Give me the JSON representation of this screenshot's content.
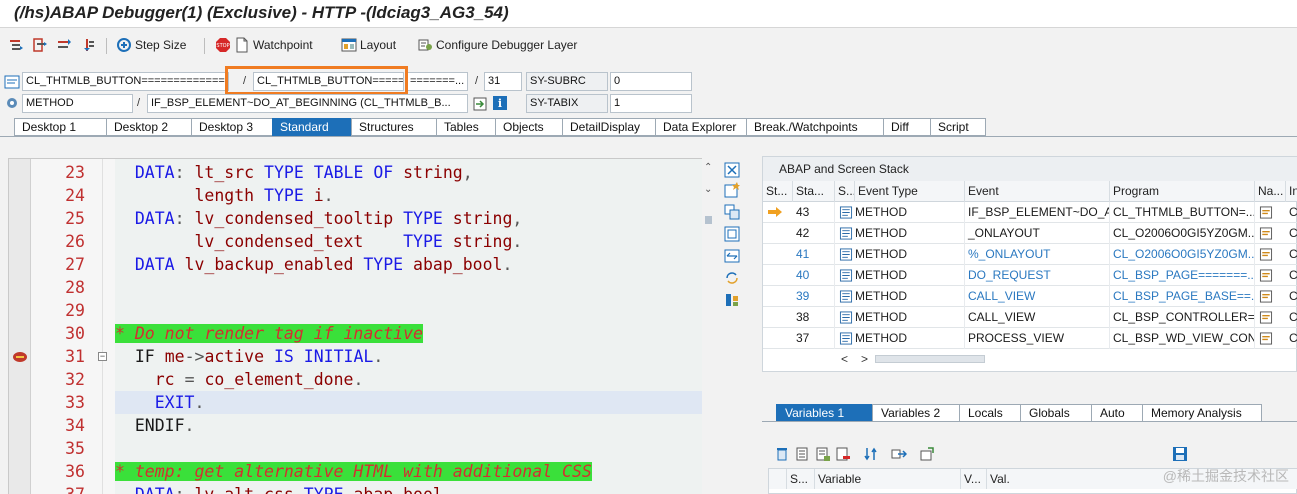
{
  "window": {
    "title": "(/hs)ABAP Debugger(1)  (Exclusive) - HTTP -(ldciag3_AG3_54)"
  },
  "toolbar": {
    "step_size": "Step Size",
    "watchpoint": "Watchpoint",
    "layout": "Layout",
    "configure": "Configure Debugger Layer"
  },
  "info": {
    "program": "CL_THTMLB_BUTTON=============",
    "include": "CL_THTMLB_BUTTON=====",
    "include_suffix": "=======...",
    "line": "31",
    "sysubrc_label": "SY-SUBRC",
    "sysubrc_value": "0",
    "event_type": "METHOD",
    "event": "IF_BSP_ELEMENT~DO_AT_BEGINNING (CL_THTMLB_B...",
    "sytabix_label": "SY-TABIX",
    "sytabix_value": "1"
  },
  "tabs": [
    "Desktop 1",
    "Desktop 2",
    "Desktop 3",
    "Standard",
    "Structures",
    "Tables",
    "Objects",
    "DetailDisplay",
    "Data Explorer",
    "Break./Watchpoints",
    "Diff",
    "Script"
  ],
  "active_tab": "Standard",
  "code": {
    "current_line": 33,
    "breakpoint_line": 31,
    "lines": [
      {
        "n": "23",
        "tokens": [
          [
            "pl",
            "  "
          ],
          [
            "kw",
            "DATA"
          ],
          [
            "op",
            ": "
          ],
          [
            "id",
            "lt_src "
          ],
          [
            "kw",
            "TYPE TABLE OF "
          ],
          [
            "id",
            "string"
          ],
          [
            "op",
            ","
          ]
        ]
      },
      {
        "n": "24",
        "tokens": [
          [
            "pl",
            "        "
          ],
          [
            "id",
            "length "
          ],
          [
            "kw",
            "TYPE "
          ],
          [
            "id",
            "i"
          ],
          [
            "op",
            "."
          ]
        ]
      },
      {
        "n": "25",
        "tokens": [
          [
            "pl",
            "  "
          ],
          [
            "kw",
            "DATA"
          ],
          [
            "op",
            ": "
          ],
          [
            "id",
            "lv_condensed_tooltip "
          ],
          [
            "kw",
            "TYPE "
          ],
          [
            "id",
            "string"
          ],
          [
            "op",
            ","
          ]
        ]
      },
      {
        "n": "26",
        "tokens": [
          [
            "pl",
            "        "
          ],
          [
            "id",
            "lv_condensed_text    "
          ],
          [
            "kw",
            "TYPE "
          ],
          [
            "id",
            "string"
          ],
          [
            "op",
            "."
          ]
        ]
      },
      {
        "n": "27",
        "tokens": [
          [
            "pl",
            "  "
          ],
          [
            "kw",
            "DATA "
          ],
          [
            "id",
            "lv_backup_enabled "
          ],
          [
            "kw",
            "TYPE "
          ],
          [
            "id",
            "abap_bool"
          ],
          [
            "op",
            "."
          ]
        ]
      },
      {
        "n": "28",
        "tokens": []
      },
      {
        "n": "29",
        "tokens": []
      },
      {
        "n": "30",
        "tokens": [
          [
            "cm",
            "* Do not render tag if inactive"
          ]
        ]
      },
      {
        "n": "31",
        "tokens": [
          [
            "pl",
            "  "
          ],
          [
            "pl",
            "IF "
          ],
          [
            "id",
            "me"
          ],
          [
            "op",
            "->"
          ],
          [
            "id",
            "active "
          ],
          [
            "kw",
            "IS INITIAL"
          ],
          [
            "op",
            "."
          ]
        ]
      },
      {
        "n": "32",
        "tokens": [
          [
            "pl",
            "    "
          ],
          [
            "id",
            "rc "
          ],
          [
            "op",
            "= "
          ],
          [
            "id",
            "co_element_done"
          ],
          [
            "op",
            "."
          ]
        ]
      },
      {
        "n": "33",
        "tokens": [
          [
            "pl",
            "    "
          ],
          [
            "kw",
            "EXIT"
          ],
          [
            "op",
            "."
          ]
        ]
      },
      {
        "n": "34",
        "tokens": [
          [
            "pl",
            "  "
          ],
          [
            "pl",
            "ENDIF"
          ],
          [
            "op",
            "."
          ]
        ]
      },
      {
        "n": "35",
        "tokens": []
      },
      {
        "n": "36",
        "tokens": [
          [
            "cm",
            "* temp: get alternative HTML with additional CSS"
          ]
        ]
      },
      {
        "n": "37",
        "tokens": [
          [
            "pl",
            "  "
          ],
          [
            "kw",
            "DATA"
          ],
          [
            "op",
            ": "
          ],
          [
            "id",
            "lv_alt_css "
          ],
          [
            "kw",
            "TYPE "
          ],
          [
            "id",
            "abap_bool"
          ]
        ]
      }
    ]
  },
  "stack": {
    "title": "ABAP and Screen Stack",
    "columns": [
      "St...",
      "Sta...",
      "S...",
      "Event Type",
      "Event",
      "Program",
      "Na...",
      "In"
    ],
    "rows": [
      {
        "level": "43",
        "type": "METHOD",
        "event": "IF_BSP_ELEMENT~DO_A...",
        "program": "CL_THTMLB_BUTTON=...",
        "inc": "CL",
        "current": true,
        "color": "black"
      },
      {
        "level": "42",
        "type": "METHOD",
        "event": "_ONLAYOUT",
        "program": "CL_O2006O0GI5YZ0GM...",
        "inc": "CL",
        "current": false,
        "color": "black"
      },
      {
        "level": "41",
        "type": "METHOD",
        "event": "%_ONLAYOUT",
        "program": "CL_O2006O0GI5YZ0GM...",
        "inc": "CL",
        "current": false,
        "color": "blue"
      },
      {
        "level": "40",
        "type": "METHOD",
        "event": "DO_REQUEST",
        "program": "CL_BSP_PAGE=======...",
        "inc": "CL",
        "current": false,
        "color": "blue"
      },
      {
        "level": "39",
        "type": "METHOD",
        "event": "CALL_VIEW",
        "program": "CL_BSP_PAGE_BASE==...",
        "inc": "CL",
        "current": false,
        "color": "blue"
      },
      {
        "level": "38",
        "type": "METHOD",
        "event": "CALL_VIEW",
        "program": "CL_BSP_CONTROLLER=...",
        "inc": "CL",
        "current": false,
        "color": "black"
      },
      {
        "level": "37",
        "type": "METHOD",
        "event": "PROCESS_VIEW",
        "program": "CL_BSP_WD_VIEW_CON...",
        "inc": "CL",
        "current": false,
        "color": "black"
      }
    ],
    "scroll": "< >"
  },
  "variables": {
    "tabs": [
      "Variables 1",
      "Variables 2",
      "Locals",
      "Globals",
      "Auto",
      "Memory Analysis"
    ],
    "active_tab": "Variables 1",
    "columns": [
      "S...",
      "Variable",
      "V...",
      "Val."
    ]
  },
  "watermark": "@稀土掘金技术社区",
  "colors": {
    "accent": "#1d6fb8",
    "highlight": "#f07c22",
    "comment_bg": "#3ae03a"
  }
}
